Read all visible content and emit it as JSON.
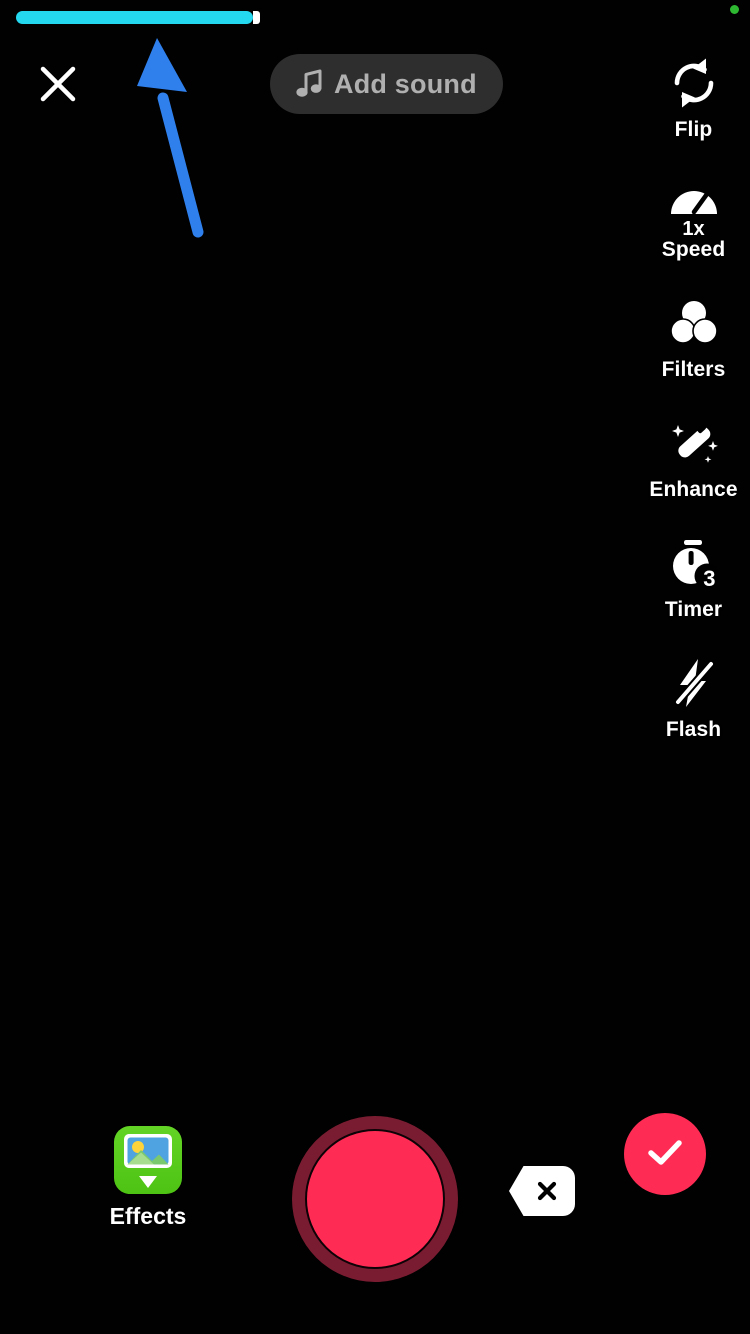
{
  "app": {
    "screen_name": "Camera Recording Screen",
    "background_color": "#000000"
  },
  "status": {
    "privacy_indicator": "green-recording-dot",
    "privacy_indicator_color": "#2eb832"
  },
  "progress": {
    "label": "recording-progress",
    "percent": 33,
    "fill_color": "#24d8ef",
    "head_color": "#ffffff",
    "track_color": "#000000"
  },
  "top_bar": {
    "close_icon": "close-x-icon",
    "add_sound": {
      "label": "Add sound",
      "icon": "music-note-icon",
      "text_color": "#b0b0b0",
      "pill_color": "#2e2e2e"
    }
  },
  "tool_rail": {
    "items": [
      {
        "id": "flip",
        "label": "Flip",
        "icon": "flip-camera-icon",
        "badge": ""
      },
      {
        "id": "speed",
        "label": "Speed",
        "icon": "speedometer-icon",
        "badge": "1x"
      },
      {
        "id": "filters",
        "label": "Filters",
        "icon": "filters-circles-icon",
        "badge": ""
      },
      {
        "id": "enhance",
        "label": "Enhance",
        "icon": "magic-wand-icon",
        "badge": ""
      },
      {
        "id": "timer",
        "label": "Timer",
        "icon": "stopwatch-icon",
        "badge": "3"
      },
      {
        "id": "flash",
        "label": "Flash",
        "icon": "flash-off-icon",
        "badge": ""
      }
    ]
  },
  "bottom_bar": {
    "effects": {
      "label": "Effects",
      "icon": "effects-gallery-download-icon",
      "tile_color": "#53c81a"
    },
    "record": {
      "label": "record-button",
      "inner_color": "#fe2c55",
      "ring_color": "#7a1c31"
    },
    "delete": {
      "label": "delete-last-clip",
      "icon": "backspace-x-icon",
      "shape_color": "#ffffff"
    },
    "confirm": {
      "label": "confirm-recording",
      "icon": "checkmark-icon",
      "color": "#fe2c55"
    }
  },
  "annotation": {
    "arrow": "blue-up-arrow-annotation",
    "color": "#2f80ed",
    "points_to": "recording-progress"
  }
}
